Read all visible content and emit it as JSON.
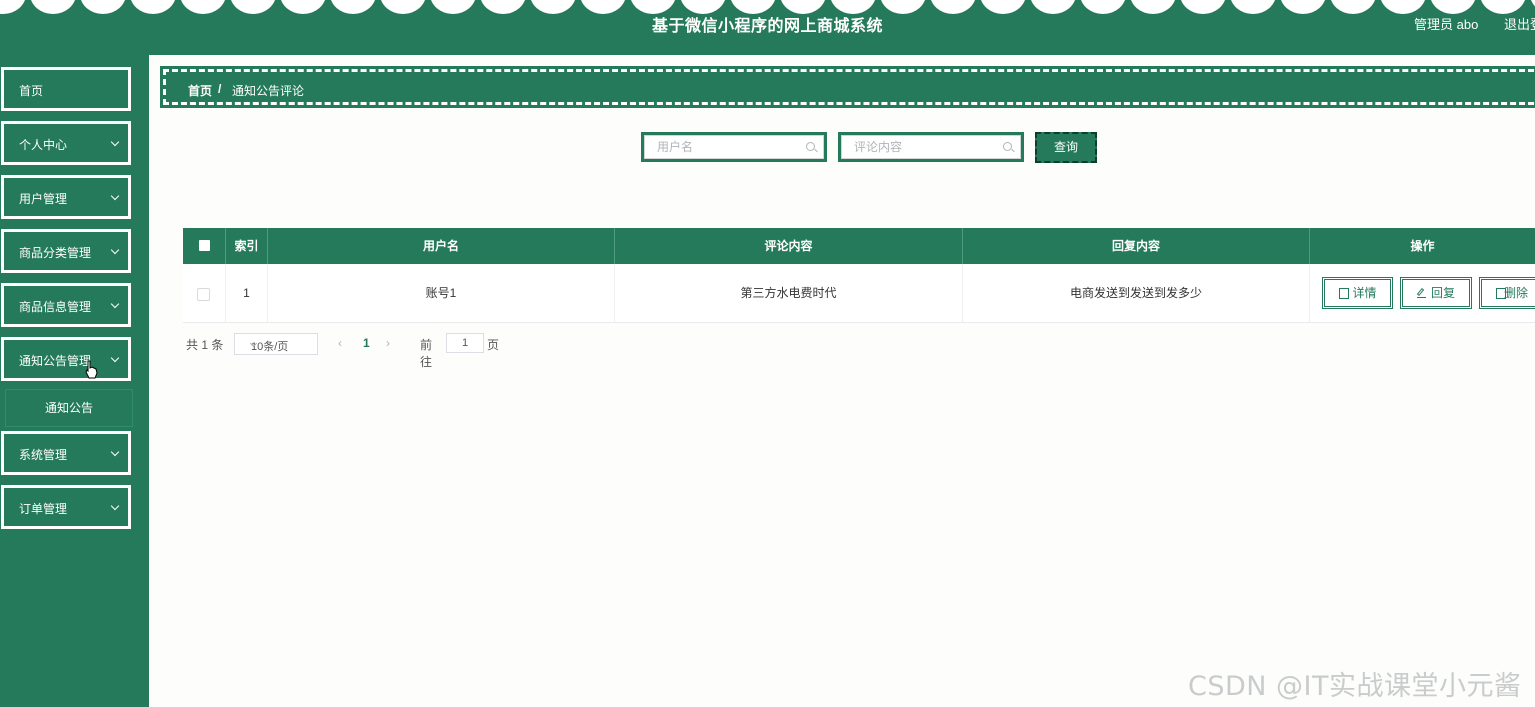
{
  "header": {
    "title": "基于微信小程序的网上商城系统",
    "user": "管理员 abo",
    "logout": "退出登录"
  },
  "sidebar": {
    "items": [
      {
        "label": "首页",
        "has_arrow": false
      },
      {
        "label": "个人中心",
        "has_arrow": true
      },
      {
        "label": "用户管理",
        "has_arrow": true
      },
      {
        "label": "商品分类管理",
        "has_arrow": true
      },
      {
        "label": "商品信息管理",
        "has_arrow": true
      },
      {
        "label": "通知公告管理",
        "has_arrow": true
      },
      {
        "label": "系统管理",
        "has_arrow": true
      },
      {
        "label": "订单管理",
        "has_arrow": true
      }
    ],
    "submenu": {
      "label": "通知公告"
    }
  },
  "breadcrumb": {
    "home": "首页",
    "separator": "/",
    "current": "通知公告评论"
  },
  "search": {
    "username_placeholder": "用户名",
    "comment_placeholder": "评论内容",
    "query_label": "查询"
  },
  "table": {
    "headers": [
      "索引",
      "用户名",
      "评论内容",
      "回复内容",
      "操作"
    ],
    "rows": [
      {
        "index": "1",
        "username": "账号1",
        "comment": "第三方水电费时代",
        "reply": "电商发送到发送到发多少"
      }
    ],
    "actions": {
      "detail": "详情",
      "reply": "回复",
      "delete": "删除"
    }
  },
  "pagination": {
    "total": "共 1 条",
    "page_size": "10条/页",
    "current_page": "1",
    "goto_label": "前往",
    "goto_value": "1",
    "page_word": "页"
  },
  "watermark": "CSDN @IT实战课堂小元酱",
  "colors": {
    "primary": "#257a5c",
    "white": "#ffffff"
  }
}
